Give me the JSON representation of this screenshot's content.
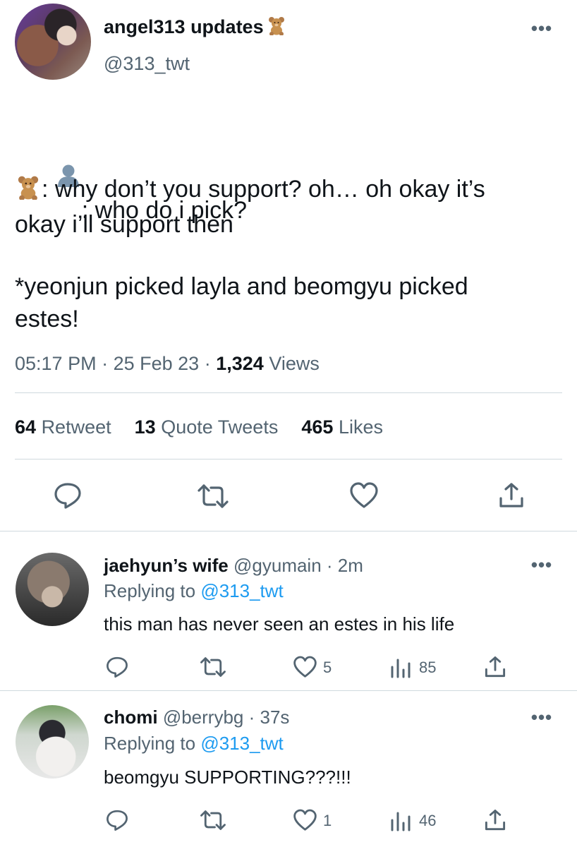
{
  "tweet": {
    "display_name": "angel313 updates",
    "name_emoji": "teddy-bear",
    "handle": "@313_twt",
    "more_label": "•••",
    "line1": ": who do i pick?",
    "line2": ": why don’t you support? oh… oh okay it’s\nokay i’ll support then",
    "line3": "*yeonjun picked layla and beomgyu picked\nestes!",
    "time": "05:17 PM",
    "date": "25 Feb 23",
    "sep": "·",
    "views_count": "1,324",
    "views_label": "Views",
    "retweets_count": "64",
    "retweets_label": "Retweet",
    "quotes_count": "13",
    "quotes_label": "Quote Tweets",
    "likes_count": "465",
    "likes_label": "Likes"
  },
  "replies": [
    {
      "display_name": "jaehyun’s wife",
      "handle": "@gyumain",
      "time": "· 2m",
      "replying_prefix": "Replying to",
      "replying_handle": "@313_twt",
      "text": "this man has never seen an estes in his life",
      "likes": "5",
      "views": "85",
      "more_label": "•••"
    },
    {
      "display_name": "chomi",
      "handle": "@berrybg",
      "time": "· 37s",
      "replying_prefix": "Replying to",
      "replying_handle": "@313_twt",
      "text": "beomgyu SUPPORTING???!!!",
      "likes": "1",
      "views": "46",
      "more_label": "•••"
    }
  ],
  "colors": {
    "text": "#0f1419",
    "secondary": "#536471",
    "link": "#1d9bf0",
    "divider": "#cfd9de"
  }
}
